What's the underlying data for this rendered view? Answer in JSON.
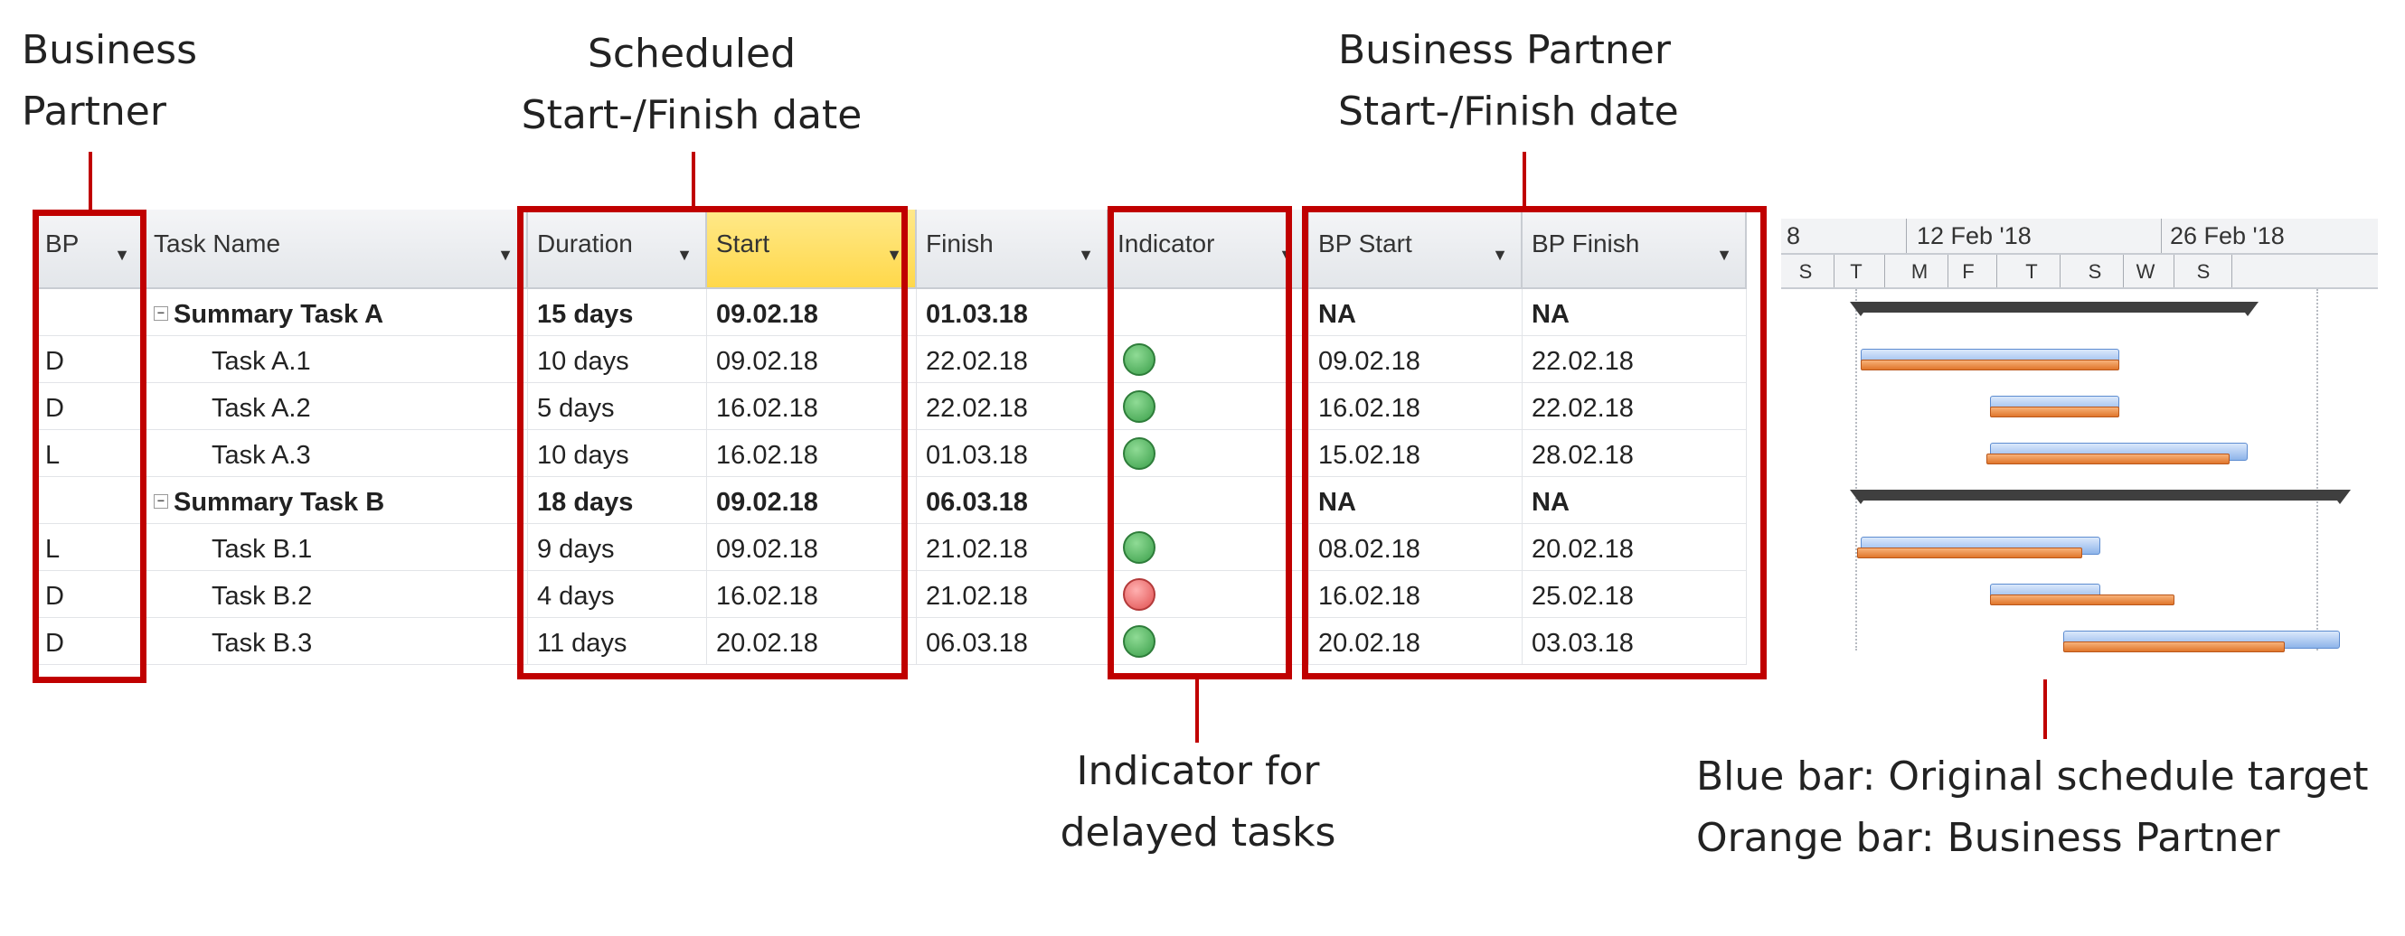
{
  "annotations": {
    "bp_line1": "Business",
    "bp_line2": "Partner",
    "sched_line1": "Scheduled",
    "sched_line2": "Start-/Finish date",
    "bpdate_line1": "Business Partner",
    "bpdate_line2": "Start-/Finish date",
    "ind_line1": "Indicator for",
    "ind_line2": "delayed tasks",
    "bar_line1": "Blue bar: Original schedule target",
    "bar_line2": "Orange bar: Business Partner"
  },
  "columns": {
    "bp": "BP",
    "task": "Task Name",
    "duration": "Duration",
    "start": "Start",
    "finish": "Finish",
    "indicator": "Indicator",
    "bp_start": "BP Start",
    "bp_finish": "BP Finish"
  },
  "rows": [
    {
      "bp": "",
      "task": "Summary Task A",
      "summary": true,
      "duration": "15 days",
      "start": "09.02.18",
      "finish": "01.03.18",
      "indicator": "",
      "bp_start": "NA",
      "bp_finish": "NA"
    },
    {
      "bp": "D",
      "task": "Task A.1",
      "summary": false,
      "duration": "10 days",
      "start": "09.02.18",
      "finish": "22.02.18",
      "indicator": "green",
      "bp_start": "09.02.18",
      "bp_finish": "22.02.18"
    },
    {
      "bp": "D",
      "task": "Task A.2",
      "summary": false,
      "duration": "5 days",
      "start": "16.02.18",
      "finish": "22.02.18",
      "indicator": "green",
      "bp_start": "16.02.18",
      "bp_finish": "22.02.18"
    },
    {
      "bp": "L",
      "task": "Task A.3",
      "summary": false,
      "duration": "10 days",
      "start": "16.02.18",
      "finish": "01.03.18",
      "indicator": "green",
      "bp_start": "15.02.18",
      "bp_finish": "28.02.18"
    },
    {
      "bp": "",
      "task": "Summary Task B",
      "summary": true,
      "duration": "18 days",
      "start": "09.02.18",
      "finish": "06.03.18",
      "indicator": "",
      "bp_start": "NA",
      "bp_finish": "NA"
    },
    {
      "bp": "L",
      "task": "Task B.1",
      "summary": false,
      "duration": "9 days",
      "start": "09.02.18",
      "finish": "21.02.18",
      "indicator": "green",
      "bp_start": "08.02.18",
      "bp_finish": "20.02.18"
    },
    {
      "bp": "D",
      "task": "Task B.2",
      "summary": false,
      "duration": "4 days",
      "start": "16.02.18",
      "finish": "21.02.18",
      "indicator": "red",
      "bp_start": "16.02.18",
      "bp_finish": "25.02.18"
    },
    {
      "bp": "D",
      "task": "Task B.3",
      "summary": false,
      "duration": "11 days",
      "start": "20.02.18",
      "finish": "06.03.18",
      "indicator": "green",
      "bp_start": "20.02.18",
      "bp_finish": "03.03.18"
    }
  ],
  "timeline": {
    "weeks": [
      "8",
      "12 Feb '18",
      "26 Feb '18"
    ],
    "days": [
      "S",
      "T",
      "M",
      "F",
      "T",
      "S",
      "W",
      "S"
    ]
  },
  "colors": {
    "annotation_red": "#c00000",
    "indicator_green": "#3b9f4a",
    "indicator_red": "#e05050",
    "bar_blue": "#8eb4ea",
    "bar_orange": "#e0762b",
    "header_selected": "#ffd84a"
  }
}
